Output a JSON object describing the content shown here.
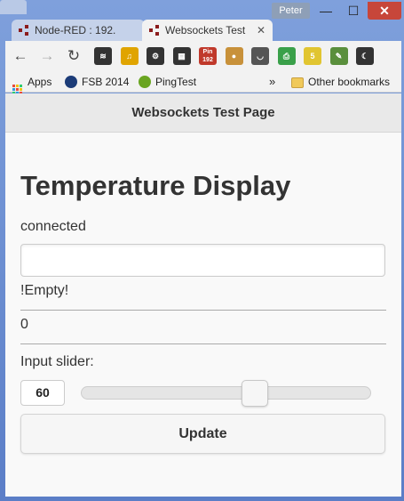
{
  "window": {
    "user_name": "Peter",
    "min_glyph": "—",
    "max_glyph": "☐",
    "close_glyph": "✕"
  },
  "tabs": [
    {
      "label": "Node-RED : 192.",
      "active": false
    },
    {
      "label": "Websockets Test",
      "active": true
    }
  ],
  "toolbar": {
    "back_glyph": "←",
    "forward_glyph": "→",
    "reload_glyph": "↻",
    "extensions": [
      {
        "icon": "layers-icon",
        "glyph": "≋",
        "color": "#333333"
      },
      {
        "icon": "note-icon",
        "glyph": "♫",
        "color": "#e0a400"
      },
      {
        "icon": "gear-icon",
        "glyph": "⚙",
        "color": "#333333"
      },
      {
        "icon": "qr-code-icon",
        "glyph": "▦",
        "color": "#333333"
      },
      {
        "icon": "pin-icon",
        "glyph": "Pin 192",
        "color": "#c0392b"
      },
      {
        "icon": "cookie-icon",
        "glyph": "●",
        "color": "#c8913a"
      },
      {
        "icon": "pocket-icon",
        "glyph": "◡",
        "color": "#555555"
      },
      {
        "icon": "print-icon",
        "glyph": "⎙",
        "color": "#3aa04a"
      },
      {
        "icon": "bulb-icon",
        "glyph": "5",
        "color": "#e1c531"
      },
      {
        "icon": "evernote-icon",
        "glyph": "✎",
        "color": "#5a8f3c"
      },
      {
        "icon": "moon-icon",
        "glyph": "☾",
        "color": "#333333"
      }
    ]
  },
  "bookmarks": {
    "items": [
      {
        "label": "Apps",
        "icon": "apps-icon"
      },
      {
        "label": "FSB 2014",
        "icon": "fsb-icon"
      },
      {
        "label": "PingTest",
        "icon": "pingtest-icon"
      }
    ],
    "overflow": "»",
    "other_label": "Other bookmarks"
  },
  "page": {
    "header_title": "Websockets Test Page",
    "heading": "Temperature Display",
    "status": "connected",
    "text_input_value": "",
    "display_text": "!Empty!",
    "display_number": "0",
    "slider_label": "Input slider:",
    "slider_value": "60",
    "slider_min": 0,
    "slider_max": 100,
    "update_label": "Update"
  }
}
